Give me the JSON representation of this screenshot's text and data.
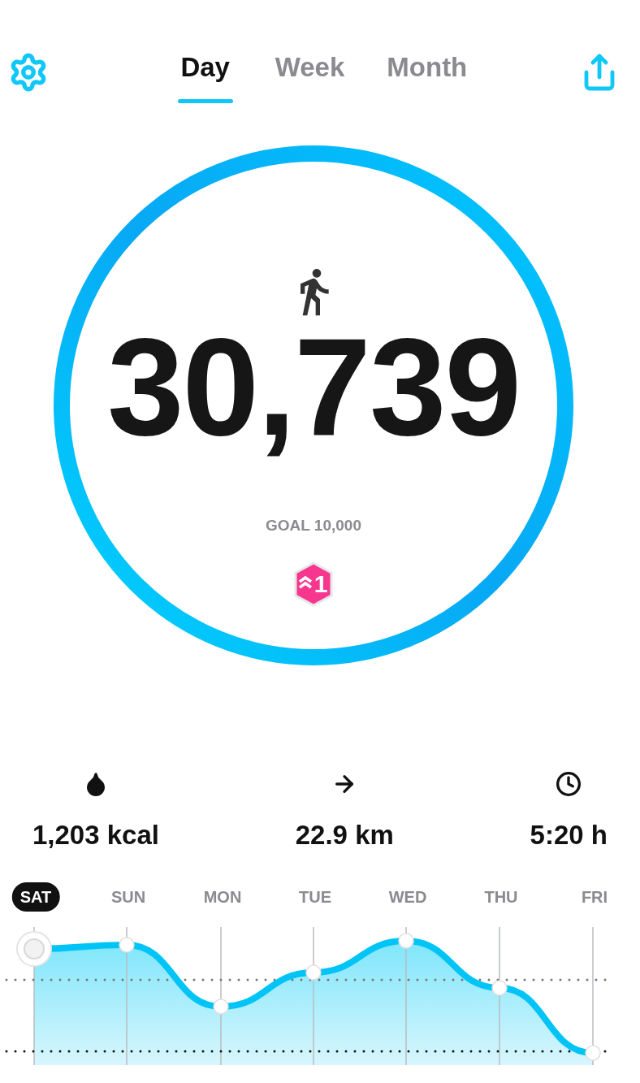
{
  "tabs": [
    {
      "label": "Day",
      "selected": true
    },
    {
      "label": "Week",
      "selected": false
    },
    {
      "label": "Month",
      "selected": false
    }
  ],
  "ring": {
    "level": 1,
    "steps": "30,739",
    "goal": "GOAL 10,000",
    "badge": "1"
  },
  "stats": [
    {
      "kind": "calories",
      "value": "1,203 kcal"
    },
    {
      "kind": "distance",
      "value": "22.9 km"
    },
    {
      "kind": "time",
      "value": "5:20 h"
    }
  ],
  "days": [
    {
      "label": "SAT",
      "selected": true
    },
    {
      "label": "SUN",
      "selected": false
    },
    {
      "label": "MON",
      "selected": false
    },
    {
      "label": "TUE",
      "selected": false
    },
    {
      "label": "WED",
      "selected": false
    },
    {
      "label": "THU",
      "selected": false
    },
    {
      "label": "FRI",
      "selected": false
    }
  ]
}
